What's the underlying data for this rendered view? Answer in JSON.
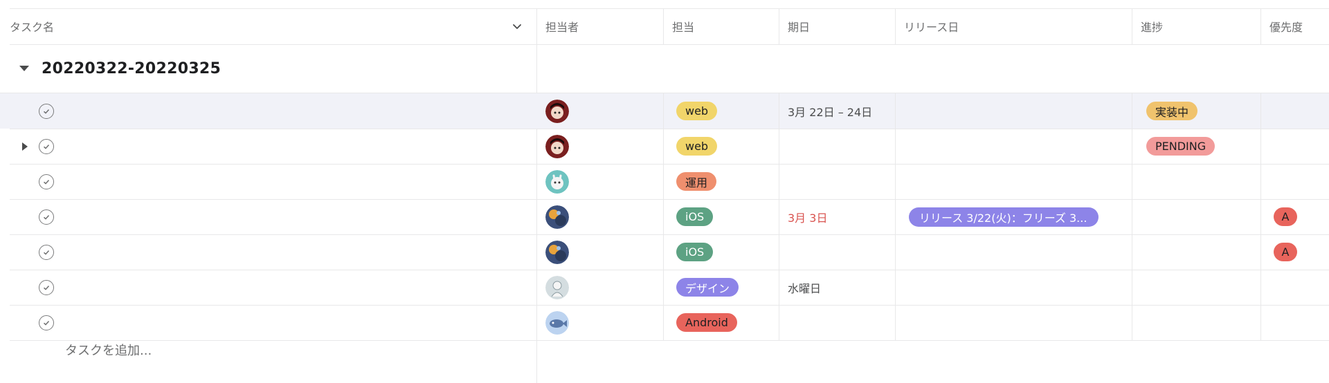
{
  "columns": {
    "task_name": "タスク名",
    "assignee": "担当者",
    "tag": "担当",
    "due_date": "期日",
    "release_date": "リリース日",
    "progress": "進捗",
    "priority": "優先度"
  },
  "group": {
    "title": "20220322-20220325"
  },
  "tags": {
    "web": {
      "label": "web",
      "color": "#f1d56a"
    },
    "ops": {
      "label": "運用",
      "color": "#ef8f6e"
    },
    "ios": {
      "label": "iOS",
      "color": "#5da283"
    },
    "design": {
      "label": "デザイン",
      "color": "#8d84e8"
    },
    "android": {
      "label": "Android",
      "color": "#e8645c"
    }
  },
  "rows": [
    {
      "tag": "web",
      "due": "3月 22日 – 24日",
      "progress": "実装中",
      "highlight": true
    },
    {
      "tag": "web",
      "progress": "PENDING",
      "expandable": true
    },
    {
      "tag": "運用"
    },
    {
      "tag": "iOS",
      "due": "3月 3日",
      "release": "リリース 3/22(火)：フリーズ 3...",
      "priority": "A"
    },
    {
      "tag": "iOS",
      "priority": "A"
    },
    {
      "tag": "デザイン",
      "due": "水曜日"
    },
    {
      "tag": "Android"
    }
  ],
  "progress_colors": {
    "in_progress": "#f0c36d",
    "pending": "#f29b9a"
  },
  "add_task": "タスクを追加..."
}
